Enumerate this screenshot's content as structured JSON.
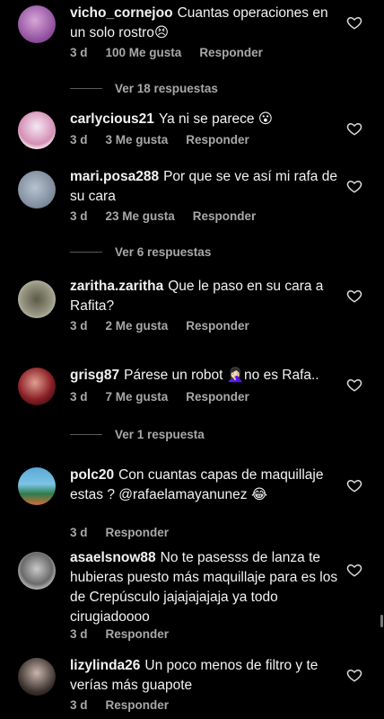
{
  "comments": [
    {
      "user": "vicho_cornejoo",
      "text": "Cuantas operaciones en un solo rostro😣",
      "time": "3 d",
      "likes": "100 Me gusta",
      "reply": "Responder"
    },
    {
      "user": "carlycious21",
      "text": "Ya ni se parece 😮",
      "time": "3 d",
      "likes": "3 Me gusta",
      "reply": "Responder"
    },
    {
      "user": "mari.posa288",
      "text": "Por que se ve así mi rafa de su cara",
      "time": "3 d",
      "likes": "23 Me gusta",
      "reply": "Responder"
    },
    {
      "user": "zaritha.zaritha",
      "text": "Que le paso en su cara a Rafita?",
      "time": "3 d",
      "likes": "2 Me gusta",
      "reply": "Responder"
    },
    {
      "user": "grisg87",
      "text": "Párese un robot 🤦🏻‍♀️no es Rafa..",
      "time": "3 d",
      "likes": "7 Me gusta",
      "reply": "Responder"
    },
    {
      "user": "polc20",
      "text": "Con cuantas capas de maquillaje estas ? @rafaelamayanunez 😂",
      "time": "3 d",
      "likes": "",
      "reply": "Responder"
    },
    {
      "user": "asaelsnow88",
      "text": "No te pasesss de lanza te hubieras puesto más maquillaje para es los de Crepúsculo jajajajajaja ya todo cirugiadoooo",
      "time": "3 d",
      "likes": "",
      "reply": "Responder"
    },
    {
      "user": "lizylinda26",
      "text": "Un poco menos de filtro y te verías más guapote",
      "time": "3 d",
      "likes": "",
      "reply": "Responder"
    }
  ],
  "view_replies": [
    "Ver 18 respuestas",
    "Ver 6 respuestas",
    "Ver 1 respuesta"
  ],
  "colors": {
    "background": "#000000",
    "text": "#f2f2f2",
    "muted": "#a8a8a8"
  }
}
